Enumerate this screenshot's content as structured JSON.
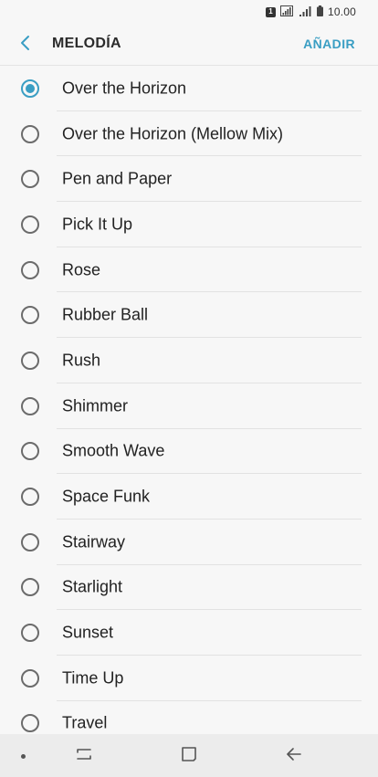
{
  "status_bar": {
    "sim_label": "1",
    "time": "10.00"
  },
  "header": {
    "title": "MELODÍA",
    "add_label": "AÑADIR"
  },
  "ringtones": [
    {
      "label": "Over the Horizon",
      "selected": true
    },
    {
      "label": "Over the Horizon (Mellow Mix)",
      "selected": false
    },
    {
      "label": "Pen and Paper",
      "selected": false
    },
    {
      "label": "Pick It Up",
      "selected": false
    },
    {
      "label": "Rose",
      "selected": false
    },
    {
      "label": "Rubber Ball",
      "selected": false
    },
    {
      "label": "Rush",
      "selected": false
    },
    {
      "label": "Shimmer",
      "selected": false
    },
    {
      "label": "Smooth Wave",
      "selected": false
    },
    {
      "label": "Space Funk",
      "selected": false
    },
    {
      "label": "Stairway",
      "selected": false
    },
    {
      "label": "Starlight",
      "selected": false
    },
    {
      "label": "Sunset",
      "selected": false
    },
    {
      "label": "Time Up",
      "selected": false
    },
    {
      "label": "Travel",
      "selected": false
    }
  ],
  "colors": {
    "accent": "#3a9ec3",
    "background": "#f7f7f7",
    "nav_background": "#ececec"
  }
}
